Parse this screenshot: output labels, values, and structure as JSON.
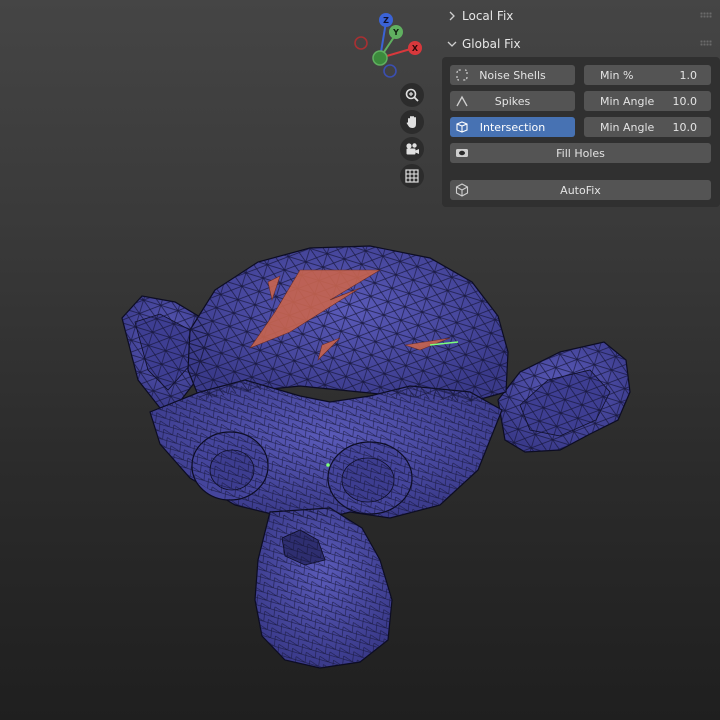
{
  "gizmo": {
    "axes": [
      {
        "label": "Z",
        "color": "#3b63d6"
      },
      {
        "label": "Y",
        "color": "#60b060"
      },
      {
        "label": "X",
        "color": "#d8383c"
      }
    ]
  },
  "viewport_tools": [
    {
      "name": "zoom-icon"
    },
    {
      "name": "pan-hand-icon"
    },
    {
      "name": "camera-icon"
    },
    {
      "name": "grid-icon"
    }
  ],
  "panel": {
    "local_fix": {
      "label": "Local Fix"
    },
    "global_fix": {
      "label": "Global Fix",
      "rows": [
        {
          "button": "Noise Shells",
          "param": "Min %",
          "value": "1.0",
          "active": false
        },
        {
          "button": "Spikes",
          "param": "Min Angle",
          "value": "10.0",
          "active": false
        },
        {
          "button": "Intersection",
          "param": "Min Angle",
          "value": "10.0",
          "active": true
        }
      ],
      "fill_holes": "Fill Holes",
      "autofix": "AutoFix"
    }
  },
  "colors": {
    "mesh_fill": "#4a4a9e",
    "mesh_wire": "#101026",
    "intersection_highlight": "#c8644e",
    "accent": "#4772b3"
  }
}
